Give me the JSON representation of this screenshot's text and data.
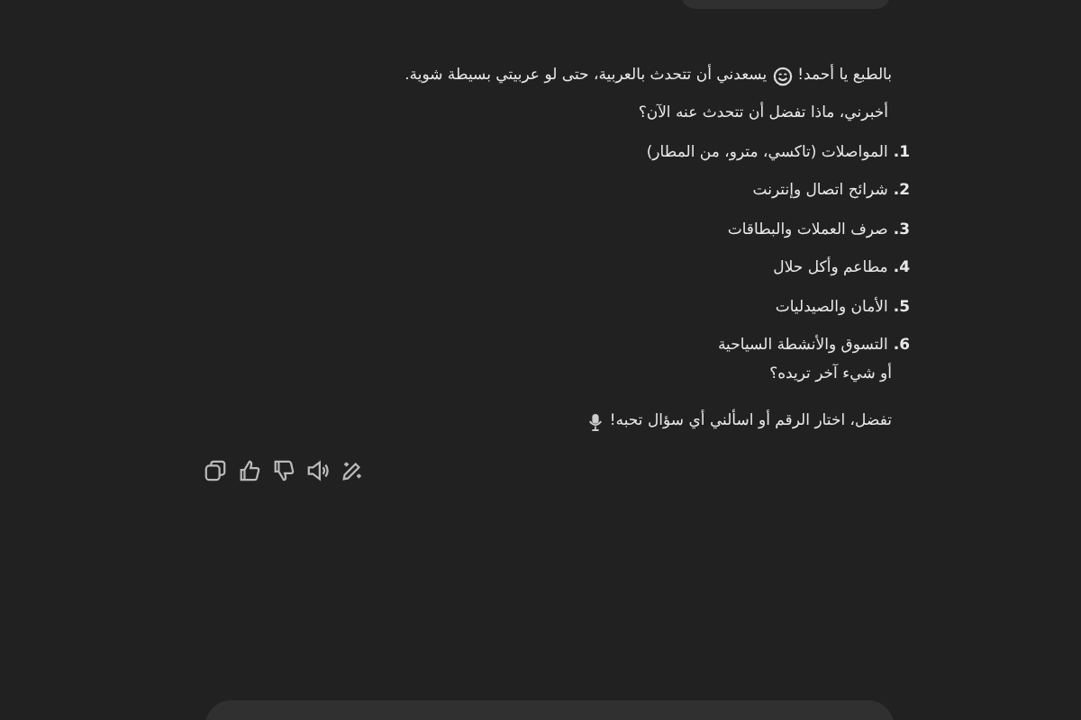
{
  "reply": {
    "greeting_before_emoji": "بالطبع يا أحمد!",
    "greeting_after_emoji": "يسعدني أن تتحدث بالعربية، حتى لو عربيتي بسيطة شوية.",
    "question": "أخبرني، ماذا تفضل أن تتحدث عنه الآن؟",
    "topics": [
      {
        "number": "1.",
        "label": "المواصلات (تاكسي، مترو، من المطار)"
      },
      {
        "number": "2.",
        "label": "شرائح اتصال وإنترنت"
      },
      {
        "number": "3.",
        "label": "صرف العملات والبطاقات"
      },
      {
        "number": "4.",
        "label": "مطاعم وأكل حلال"
      },
      {
        "number": "5.",
        "label": "الأمان والصيدليات"
      },
      {
        "number": "6.",
        "label": "التسوق والأنشطة السياحية"
      }
    ],
    "other": "أو شيء آخر تريده؟",
    "closing": "تفضل، اختار الرقم أو اسألني أي سؤال تحبه!"
  }
}
